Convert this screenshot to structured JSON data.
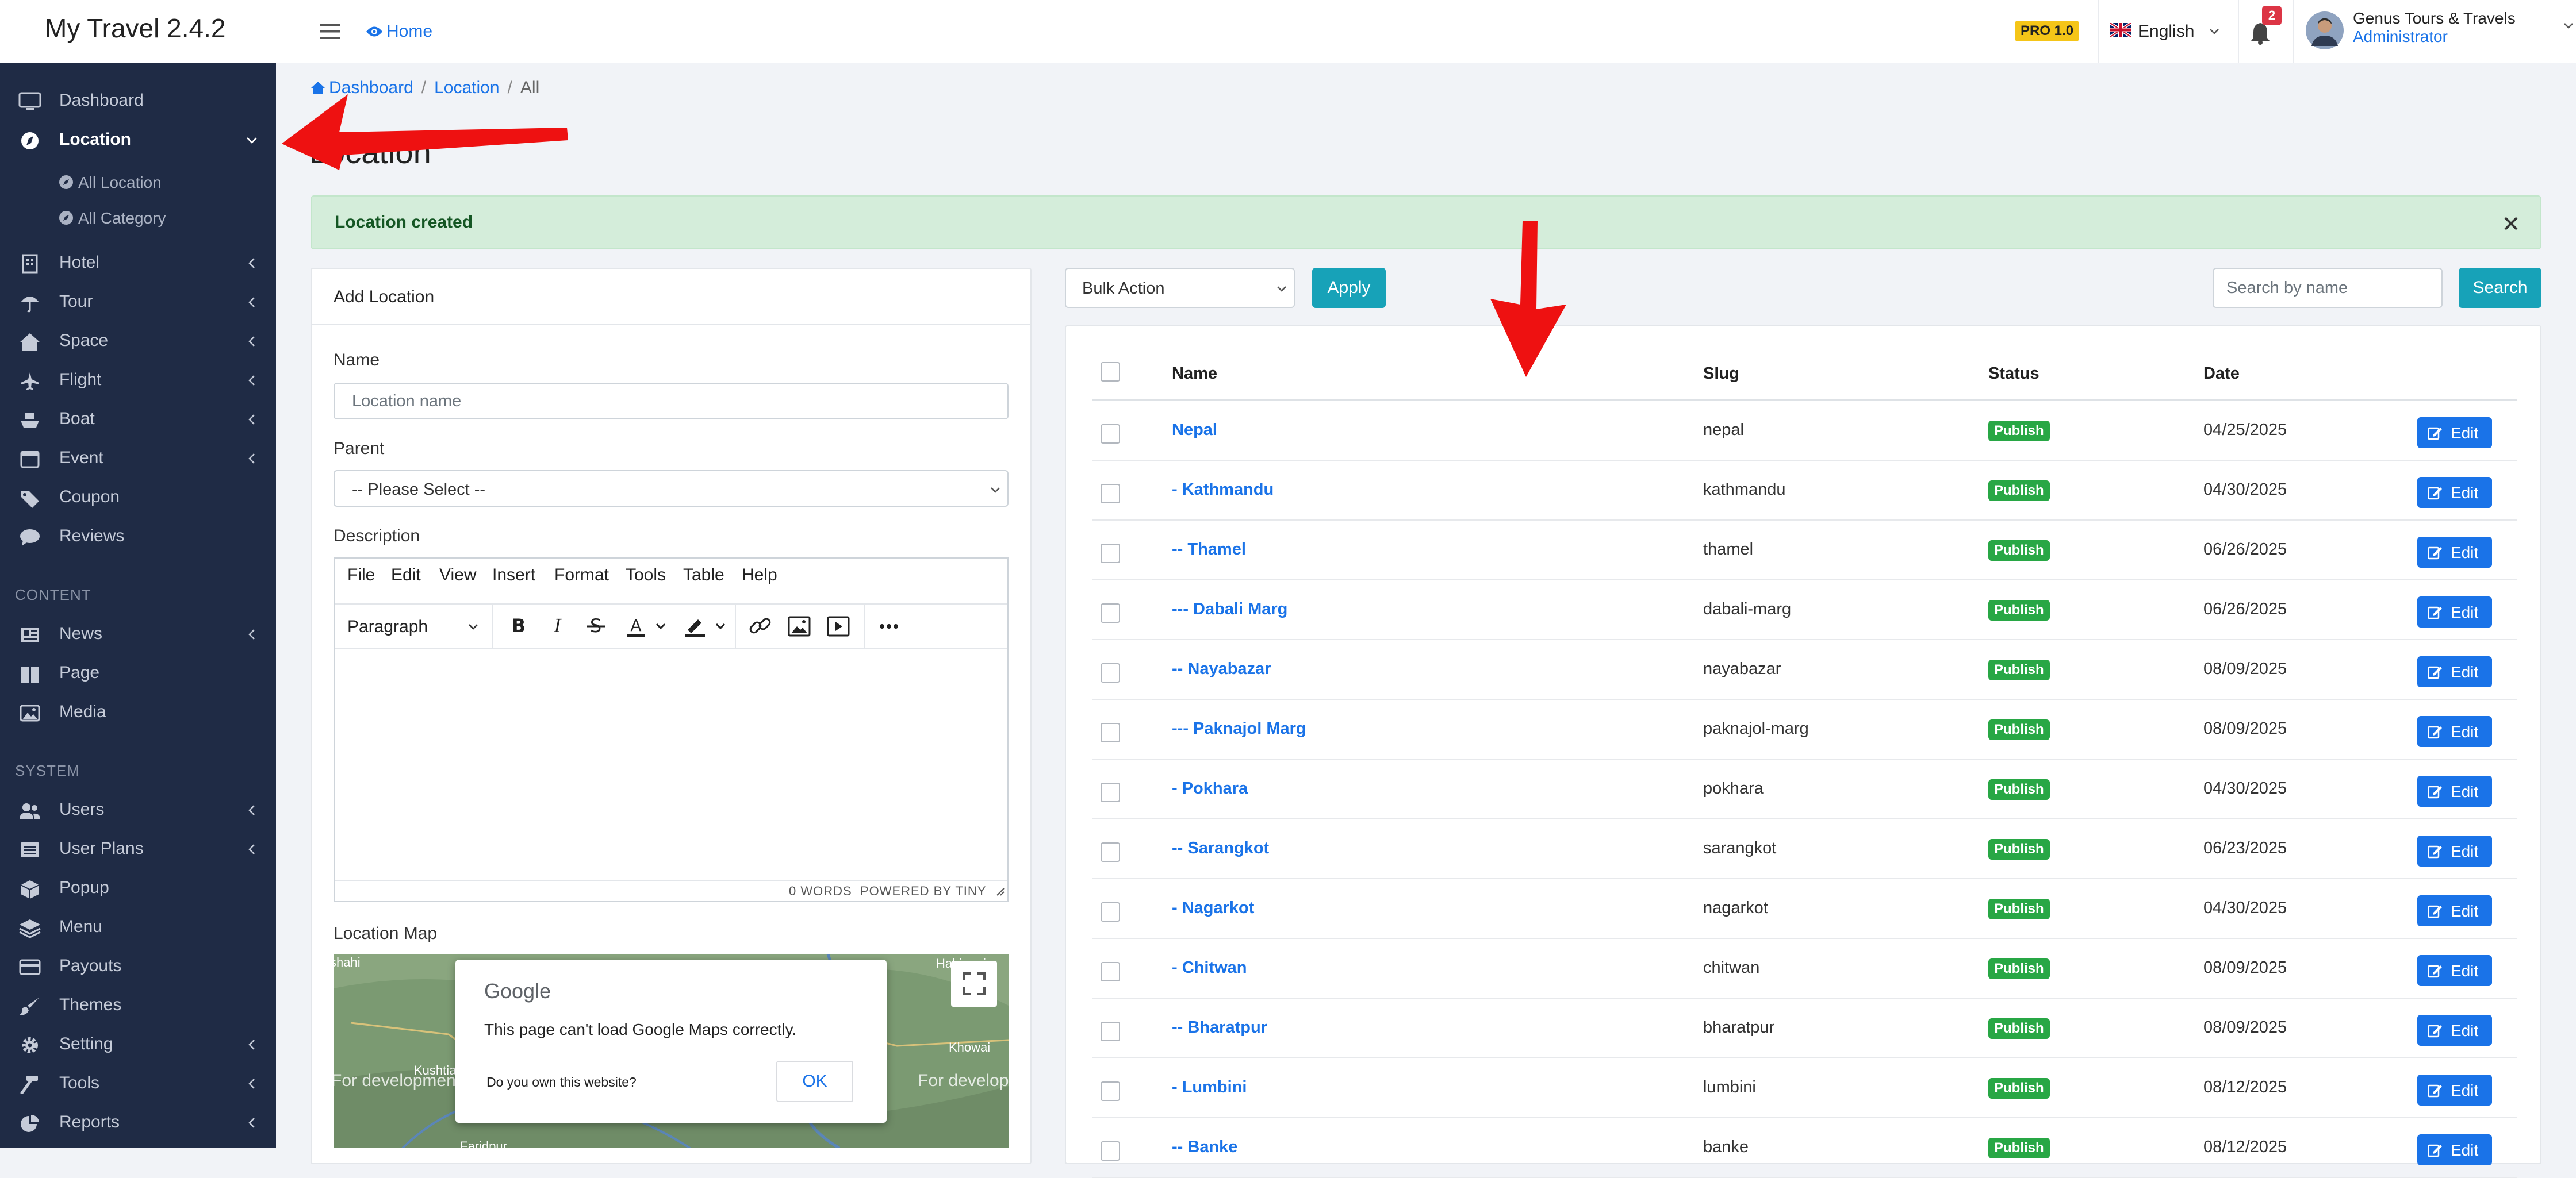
{
  "app": {
    "title": "My Travel 2.4.2"
  },
  "topbar": {
    "home_label": "Home",
    "pro_badge": "PRO 1.0",
    "language": "English",
    "notification_count": "2",
    "user_name": "Genus Tours & Travels",
    "user_role": "Administrator"
  },
  "sidebar": {
    "items": [
      {
        "label": "Dashboard",
        "icon": "monitor-icon"
      },
      {
        "label": "Location",
        "icon": "compass-icon"
      },
      {
        "label": "Hotel",
        "icon": "building-icon"
      },
      {
        "label": "Tour",
        "icon": "umbrella-icon"
      },
      {
        "label": "Space",
        "icon": "home-icon"
      },
      {
        "label": "Flight",
        "icon": "plane-icon"
      },
      {
        "label": "Boat",
        "icon": "ship-icon"
      },
      {
        "label": "Event",
        "icon": "calendar-icon"
      },
      {
        "label": "Coupon",
        "icon": "tag-icon"
      },
      {
        "label": "Reviews",
        "icon": "comment-icon"
      }
    ],
    "sub_items": [
      "All Location",
      "All Category"
    ],
    "content_label": "CONTENT",
    "content_items": [
      {
        "label": "News",
        "icon": "newspaper-icon"
      },
      {
        "label": "Page",
        "icon": "book-icon"
      },
      {
        "label": "Media",
        "icon": "image-icon"
      }
    ],
    "system_label": "SYSTEM",
    "system_items": [
      {
        "label": "Users",
        "icon": "users-icon"
      },
      {
        "label": "User Plans",
        "icon": "list-icon"
      },
      {
        "label": "Popup",
        "icon": "cube-icon"
      },
      {
        "label": "Menu",
        "icon": "layers-icon"
      },
      {
        "label": "Payouts",
        "icon": "credit-card-icon"
      },
      {
        "label": "Themes",
        "icon": "brush-icon"
      },
      {
        "label": "Setting",
        "icon": "gear-icon"
      },
      {
        "label": "Tools",
        "icon": "hammer-icon"
      },
      {
        "label": "Reports",
        "icon": "pie-chart-icon"
      }
    ]
  },
  "breadcrumb": {
    "items": [
      "Dashboard",
      "Location",
      "All"
    ]
  },
  "page": {
    "title": "Location"
  },
  "alert": {
    "message": "Location created"
  },
  "form": {
    "heading": "Add Location",
    "name_label": "Name",
    "name_placeholder": "Location name",
    "parent_label": "Parent",
    "parent_value": "-- Please Select --",
    "description_label": "Description",
    "editor_menu": [
      "File",
      "Edit",
      "View",
      "Insert",
      "Format",
      "Tools",
      "Table",
      "Help"
    ],
    "editor_block_format": "Paragraph",
    "editor_status": "0 WORDS  POWERED BY TINY",
    "map_label": "Location Map",
    "map_error_brand": "Google",
    "map_error_message": "This page can't load Google Maps correctly.",
    "map_error_question": "Do you own this website?",
    "map_error_ok": "OK",
    "map_watermark_left": "For development",
    "map_watermark_right": "For develop",
    "map_place_labels": [
      "Kushtia",
      "Faridpur",
      "Habigani",
      "Khowai",
      "ahi",
      "shahi"
    ]
  },
  "list": {
    "bulk_action": "Bulk Action",
    "apply_label": "Apply",
    "search_placeholder": "Search by name",
    "search_button": "Search",
    "columns": [
      "Name",
      "Slug",
      "Status",
      "Date"
    ],
    "edit_label": "Edit",
    "rows": [
      {
        "name": "Nepal",
        "slug": "nepal",
        "status": "Publish",
        "date": "04/25/2025"
      },
      {
        "name": "- Kathmandu",
        "slug": "kathmandu",
        "status": "Publish",
        "date": "04/30/2025"
      },
      {
        "name": "-- Thamel",
        "slug": "thamel",
        "status": "Publish",
        "date": "06/26/2025"
      },
      {
        "name": "--- Dabali Marg",
        "slug": "dabali-marg",
        "status": "Publish",
        "date": "06/26/2025"
      },
      {
        "name": "-- Nayabazar",
        "slug": "nayabazar",
        "status": "Publish",
        "date": "08/09/2025"
      },
      {
        "name": "--- Paknajol Marg",
        "slug": "paknajol-marg",
        "status": "Publish",
        "date": "08/09/2025"
      },
      {
        "name": "- Pokhara",
        "slug": "pokhara",
        "status": "Publish",
        "date": "04/30/2025"
      },
      {
        "name": "-- Sarangkot",
        "slug": "sarangkot",
        "status": "Publish",
        "date": "06/23/2025"
      },
      {
        "name": "- Nagarkot",
        "slug": "nagarkot",
        "status": "Publish",
        "date": "04/30/2025"
      },
      {
        "name": "- Chitwan",
        "slug": "chitwan",
        "status": "Publish",
        "date": "08/09/2025"
      },
      {
        "name": "-- Bharatpur",
        "slug": "bharatpur",
        "status": "Publish",
        "date": "08/09/2025"
      },
      {
        "name": "- Lumbini",
        "slug": "lumbini",
        "status": "Publish",
        "date": "08/12/2025"
      },
      {
        "name": "-- Banke",
        "slug": "banke",
        "status": "Publish",
        "date": "08/12/2025"
      }
    ]
  },
  "colors": {
    "sidebar_bg": "#1f2b45",
    "link": "#1a73e8",
    "publish_badge": "#28a745",
    "button_teal": "#17a2b8",
    "alert_bg": "#d4edda",
    "annotation_arrow": "#ee1111"
  }
}
